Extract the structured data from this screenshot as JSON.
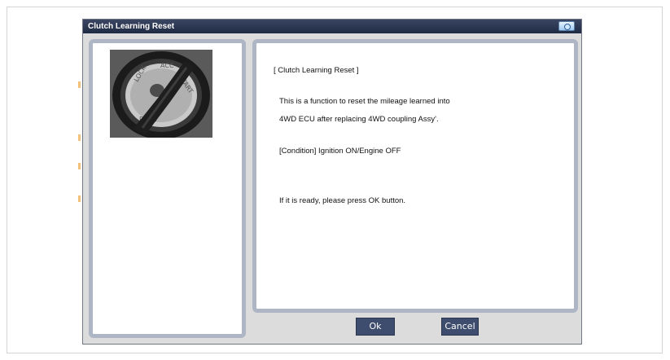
{
  "dialog": {
    "title": "Clutch Learning Reset",
    "camera_icon": "camera-icon"
  },
  "image": {
    "description_icon": "ignition-key-icon"
  },
  "content": {
    "heading": "[ Clutch Learning Reset ]",
    "line1": "This is a function to reset the  mileage learned into",
    "line2": "4WD ECU after replacing 4WD coupling Assy'.",
    "condition": "[Condition] Ignition ON/Engine OFF",
    "ready": "If it is ready, please press OK button."
  },
  "buttons": {
    "ok": "Ok",
    "cancel": "Cancel"
  },
  "colors": {
    "titlebar": "#1f2a44",
    "button": "#3e4d6e",
    "panel_border": "#aeb6c6"
  }
}
